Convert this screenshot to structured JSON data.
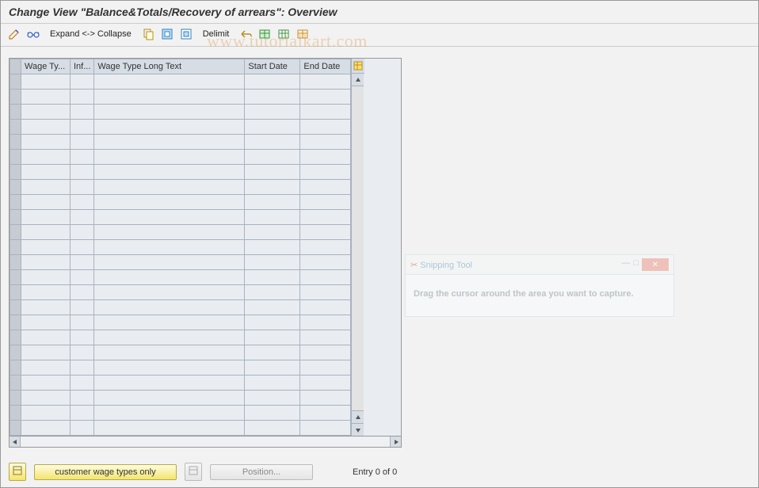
{
  "title": "Change View \"Balance&Totals/Recovery of arrears\": Overview",
  "toolbar": {
    "expand": "Expand <-> Collapse",
    "delimit": "Delimit"
  },
  "columns": {
    "c0": "",
    "c1": "Wage Ty...",
    "c2": "Inf...",
    "c3": "Wage Type Long Text",
    "c4": "Start Date",
    "c5": "End Date"
  },
  "footer": {
    "customer_btn": "customer wage types only",
    "position_btn": "Position...",
    "entry": "Entry 0 of 0"
  },
  "watermark": "www.tutorialkart.com",
  "ghost": {
    "title": "Snipping Tool",
    "body": "Drag the cursor around the area you want to capture."
  },
  "row_count": 24
}
